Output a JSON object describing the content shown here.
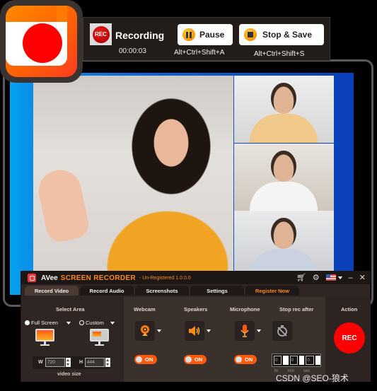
{
  "recording_toolbar": {
    "badge_label": "REC",
    "status": "Recording",
    "elapsed_time": "00:00:03",
    "pause_label": "Pause",
    "pause_shortcut": "Alt+Ctrl+Shift+A",
    "stop_label": "Stop & Save",
    "stop_shortcut": "Alt+Ctrl+Shift+S"
  },
  "window": {
    "brand": "AVee",
    "product": "SCREEN RECORDER",
    "registration": "- Un-Registered 1.0.0.0",
    "controls": {
      "minimize": "–",
      "close": "✕"
    },
    "tabs": [
      {
        "label": "Record Video",
        "active": true
      },
      {
        "label": "Record Audio",
        "active": false
      },
      {
        "label": "Screenshots",
        "active": false
      },
      {
        "label": "Settings",
        "active": false
      },
      {
        "label": "Register Now",
        "active": false
      }
    ]
  },
  "select_area": {
    "title": "Select Area",
    "options": [
      {
        "label": "Full Screen",
        "selected": true
      },
      {
        "label": "Custom",
        "selected": false
      }
    ],
    "width_label": "W",
    "width_value": "720",
    "height_label": "H",
    "height_value": "444",
    "caption": "video size"
  },
  "devices": [
    {
      "title": "Webcam",
      "toggle": "ON"
    },
    {
      "title": "Speakers",
      "toggle": "ON"
    },
    {
      "title": "Microphone",
      "toggle": "ON"
    }
  ],
  "stop_rec_after": {
    "title": "Stop rec after",
    "hours": "0",
    "minutes": "0",
    "seconds": "0",
    "labels": [
      "hr",
      "min",
      "sec"
    ]
  },
  "action": {
    "title": "Action",
    "rec_label": "REC"
  },
  "watermark": "CSDN @SEO-狼术",
  "colors": {
    "accent": "#ff8a1a",
    "rec_red": "#ff0000",
    "toggle_on": "#ff5a0a"
  }
}
